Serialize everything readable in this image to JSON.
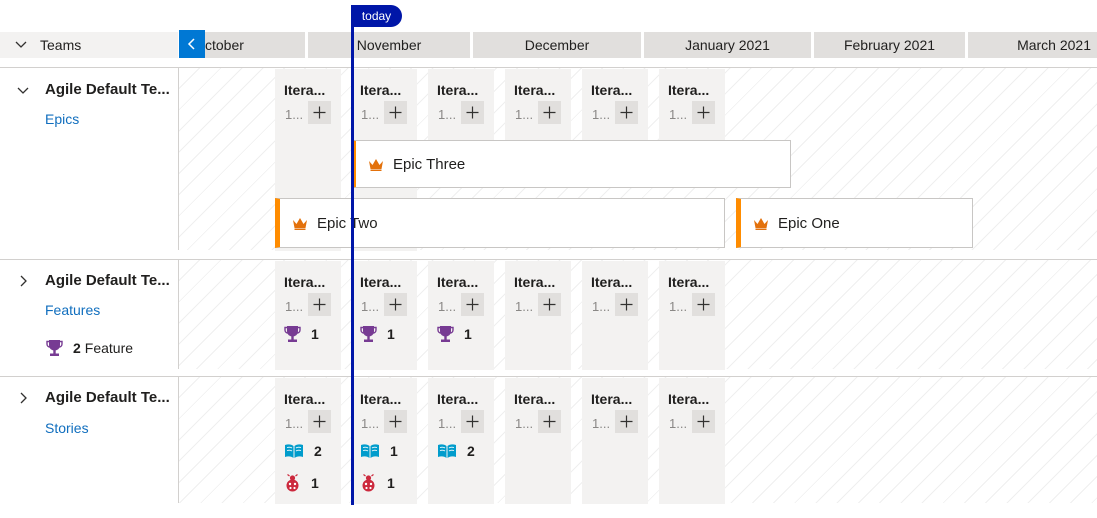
{
  "timeline": {
    "today_label": "today",
    "teams_header": "Teams",
    "months": [
      "ctober",
      "November",
      "December",
      "January 2021",
      "February 2021",
      "March 2021"
    ]
  },
  "groups": [
    {
      "title": "Agile Default Te...",
      "backlog_link": "Epics",
      "expanded": true,
      "iterations": [
        {
          "name": "Itera...",
          "date": "1..."
        },
        {
          "name": "Itera...",
          "date": "1..."
        },
        {
          "name": "Itera...",
          "date": "1..."
        },
        {
          "name": "Itera...",
          "date": "1..."
        },
        {
          "name": "Itera...",
          "date": "1..."
        },
        {
          "name": "Itera...",
          "date": "1..."
        }
      ],
      "epics": [
        {
          "title": "Epic Three",
          "icon": "crown-icon"
        },
        {
          "title": "Epic Two",
          "icon": "crown-icon"
        },
        {
          "title": "Epic One",
          "icon": "crown-icon"
        }
      ]
    },
    {
      "title": "Agile Default Te...",
      "backlog_link": "Features",
      "expanded": false,
      "summary": {
        "icon": "trophy-icon",
        "count": "2",
        "label": "Feature"
      },
      "iterations": [
        {
          "name": "Itera...",
          "date": "1...",
          "rollups": [
            {
              "icon": "trophy-icon",
              "count": "1"
            }
          ]
        },
        {
          "name": "Itera...",
          "date": "1...",
          "rollups": [
            {
              "icon": "trophy-icon",
              "count": "1"
            }
          ]
        },
        {
          "name": "Itera...",
          "date": "1...",
          "rollups": [
            {
              "icon": "trophy-icon",
              "count": "1"
            }
          ]
        },
        {
          "name": "Itera...",
          "date": "1..."
        },
        {
          "name": "Itera...",
          "date": "1..."
        },
        {
          "name": "Itera...",
          "date": "1..."
        }
      ]
    },
    {
      "title": "Agile Default Te...",
      "backlog_link": "Stories",
      "expanded": false,
      "iterations": [
        {
          "name": "Itera...",
          "date": "1...",
          "rollups": [
            {
              "icon": "book-icon",
              "count": "2"
            },
            {
              "icon": "bug-icon",
              "count": "1"
            }
          ]
        },
        {
          "name": "Itera...",
          "date": "1...",
          "rollups": [
            {
              "icon": "book-icon",
              "count": "1"
            },
            {
              "icon": "bug-icon",
              "count": "1"
            }
          ]
        },
        {
          "name": "Itera...",
          "date": "1...",
          "rollups": [
            {
              "icon": "book-icon",
              "count": "2"
            }
          ]
        },
        {
          "name": "Itera...",
          "date": "1..."
        },
        {
          "name": "Itera...",
          "date": "1..."
        },
        {
          "name": "Itera...",
          "date": "1..."
        }
      ]
    }
  ],
  "colors": {
    "accent": "#0078d4",
    "today": "#0016a8",
    "epic_border": "#ff8c00",
    "crown": "#e3710b",
    "trophy": "#773b93",
    "book": "#009ccc",
    "bug": "#cc293d",
    "link": "#106ebe"
  }
}
